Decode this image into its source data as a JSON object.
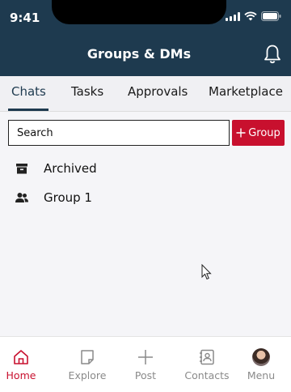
{
  "status_bar": {
    "time": "9:41"
  },
  "header": {
    "title": "Groups & DMs"
  },
  "tabs": [
    {
      "label": "Chats",
      "active": true
    },
    {
      "label": "Tasks",
      "active": false
    },
    {
      "label": "Approvals",
      "active": false
    },
    {
      "label": "Marketplace",
      "active": false
    }
  ],
  "search": {
    "placeholder": "Search",
    "value": ""
  },
  "actions": {
    "add_group_label": "Group"
  },
  "list": [
    {
      "label": "Archived",
      "icon": "archive-icon"
    },
    {
      "label": "Group 1",
      "icon": "people-icon"
    }
  ],
  "bottom_nav": [
    {
      "label": "Home",
      "icon": "home-icon",
      "active": true
    },
    {
      "label": "Explore",
      "icon": "explore-icon",
      "active": false
    },
    {
      "label": "Post",
      "icon": "plus-icon",
      "active": false
    },
    {
      "label": "Contacts",
      "icon": "contacts-icon",
      "active": false
    },
    {
      "label": "Menu",
      "icon": "avatar",
      "active": false
    }
  ],
  "colors": {
    "header_bg": "#1e3a4f",
    "accent": "#c8102e",
    "inactive": "#8a8a8a"
  }
}
